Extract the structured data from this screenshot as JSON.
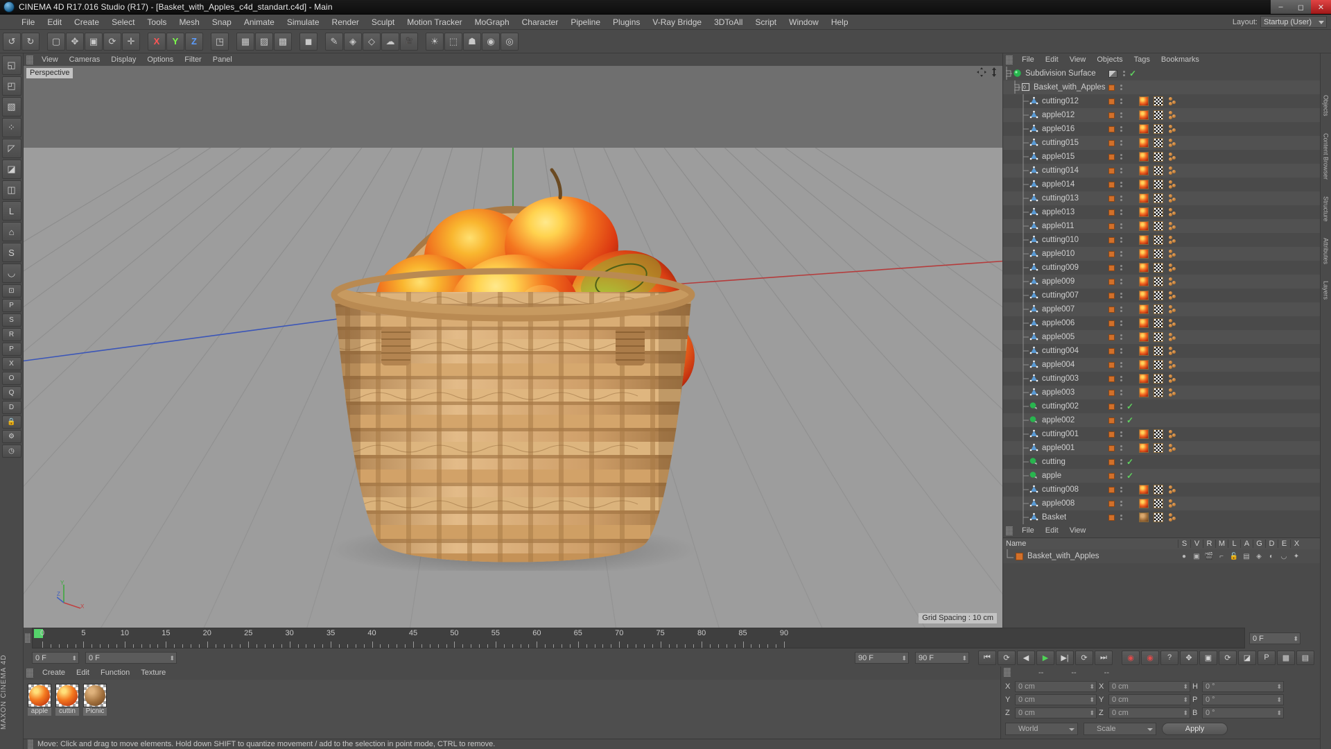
{
  "window": {
    "title": "CINEMA 4D R17.016 Studio (R17) - [Basket_with_Apples_c4d_standart.c4d] - Main",
    "app_icon": "c4d-logo-icon",
    "minimize": "–",
    "maximize": "◻",
    "close": "✕"
  },
  "menubar": {
    "items": [
      "File",
      "Edit",
      "Create",
      "Select",
      "Tools",
      "Mesh",
      "Snap",
      "Animate",
      "Simulate",
      "Render",
      "Sculpt",
      "Motion Tracker",
      "MoGraph",
      "Character",
      "Pipeline",
      "Plugins",
      "V-Ray Bridge",
      "3DToAll",
      "Script",
      "Window",
      "Help"
    ],
    "layout_label": "Layout:",
    "layout_value": "Startup (User)"
  },
  "toolbar": {
    "buttons": [
      {
        "name": "undo-button",
        "glyph": "↺"
      },
      {
        "name": "redo-button",
        "glyph": "↻"
      },
      {
        "name": "live-selection-button",
        "glyph": "▢"
      },
      {
        "name": "move-button",
        "glyph": "✥"
      },
      {
        "name": "scale-button",
        "glyph": "▣"
      },
      {
        "name": "rotate-button",
        "glyph": "⟳"
      },
      {
        "name": "coordinate-button",
        "glyph": "✛"
      },
      {
        "name": "lock-x-axis-button",
        "glyph": "X"
      },
      {
        "name": "lock-y-axis-button",
        "glyph": "Y"
      },
      {
        "name": "lock-z-axis-button",
        "glyph": "Z"
      },
      {
        "name": "world-object-coordinates-button",
        "glyph": "◳"
      },
      {
        "name": "render-view-button",
        "glyph": "▦"
      },
      {
        "name": "render-region-button",
        "glyph": "▨"
      },
      {
        "name": "render-settings-button",
        "glyph": "▩"
      },
      {
        "name": "add-cube-button",
        "glyph": "◼"
      },
      {
        "name": "add-spline-button",
        "glyph": "✎"
      },
      {
        "name": "add-generator-button",
        "glyph": "◈"
      },
      {
        "name": "add-deformer-button",
        "glyph": "◇"
      },
      {
        "name": "add-environment-button",
        "glyph": "☁"
      },
      {
        "name": "add-camera-button",
        "glyph": "🎥"
      },
      {
        "name": "add-light-button",
        "glyph": "☀"
      },
      {
        "name": "mograph-button",
        "glyph": "⬚"
      },
      {
        "name": "add-character-button",
        "glyph": "☗"
      },
      {
        "name": "add-dynamics-button",
        "glyph": "◉"
      },
      {
        "name": "add-motion-tracker-button",
        "glyph": "◎"
      }
    ]
  },
  "left_rail": {
    "buttons": [
      {
        "name": "make-editable-button",
        "glyph": "◱"
      },
      {
        "name": "model-mode-button",
        "glyph": "◰"
      },
      {
        "name": "texture-mode-button",
        "glyph": "▧"
      },
      {
        "name": "points-mode-button",
        "glyph": "⁘"
      },
      {
        "name": "edges-mode-button",
        "glyph": "◸"
      },
      {
        "name": "polygons-mode-button",
        "glyph": "◪"
      },
      {
        "name": "axis-mode-button",
        "glyph": "◫"
      },
      {
        "name": "enable-axis-button",
        "glyph": "L"
      },
      {
        "name": "workplane-button",
        "glyph": "⌂"
      },
      {
        "name": "snap-button",
        "glyph": "S"
      },
      {
        "name": "magnet-button",
        "glyph": "◡"
      },
      {
        "name": "viewport-solo-button",
        "glyph": "⊡"
      },
      {
        "name": "viewport-single-button",
        "glyph": "P"
      },
      {
        "name": "viewport-s-button",
        "glyph": "S"
      },
      {
        "name": "viewport-r-button",
        "glyph": "R"
      },
      {
        "name": "viewport-p-button",
        "glyph": "P"
      },
      {
        "name": "viewport-x-button",
        "glyph": "X"
      },
      {
        "name": "viewport-o-button",
        "glyph": "O"
      },
      {
        "name": "viewport-q-button",
        "glyph": "Q"
      },
      {
        "name": "viewport-d-button",
        "glyph": "D"
      },
      {
        "name": "lock-selection-button",
        "glyph": "🔒"
      },
      {
        "name": "settings-gear-button",
        "glyph": "⚙"
      },
      {
        "name": "render-queue-button",
        "glyph": "◷"
      }
    ],
    "brand": "MAXON CINEMA 4D"
  },
  "viewport": {
    "menu": [
      "View",
      "Cameras",
      "Display",
      "Options",
      "Filter",
      "Panel"
    ],
    "camera_label": "Perspective",
    "grid_spacing": "Grid Spacing : 10 cm",
    "pan_icon": "pan-icon",
    "zoom_icon": "zoom-icon",
    "axis_labels": {
      "x": "X",
      "y": "Y",
      "z": "Z"
    },
    "grid_color": "#8e8e8e",
    "sky_color": "#6f6f6f",
    "ground_color": "#9d9d9d",
    "axis_red": "#c04040",
    "axis_green": "#3ea83e",
    "axis_blue": "#4060c0"
  },
  "object_manager": {
    "menu": [
      "File",
      "Edit",
      "View",
      "Objects",
      "Tags",
      "Bookmarks"
    ],
    "rows": [
      {
        "name": "Subdivision Surface",
        "depth": 0,
        "icon": "subdivision-surface-icon",
        "icon_color": "#29b54f",
        "swatch": "checker",
        "check": true,
        "tags": []
      },
      {
        "name": "Basket_with_Apples",
        "depth": 1,
        "icon": "layer-object-icon",
        "icon_color": "#cfcfcf",
        "swatch": "orange",
        "check": false,
        "tags": []
      },
      {
        "name": "cutting012",
        "depth": 2,
        "icon": "polygon-object-icon",
        "icon_color": "#5b9bd5",
        "swatch": "orange",
        "check": false,
        "tags": [
          "apple",
          "checker",
          "dots"
        ]
      },
      {
        "name": "apple012",
        "depth": 2,
        "icon": "polygon-object-icon",
        "icon_color": "#5b9bd5",
        "swatch": "orange",
        "check": false,
        "tags": [
          "apple",
          "checker",
          "dots"
        ]
      },
      {
        "name": "apple016",
        "depth": 2,
        "icon": "polygon-object-icon",
        "icon_color": "#5b9bd5",
        "swatch": "orange",
        "check": false,
        "tags": [
          "apple",
          "checker",
          "dots"
        ]
      },
      {
        "name": "cutting015",
        "depth": 2,
        "icon": "polygon-object-icon",
        "icon_color": "#5b9bd5",
        "swatch": "orange",
        "check": false,
        "tags": [
          "apple",
          "checker",
          "dots"
        ]
      },
      {
        "name": "apple015",
        "depth": 2,
        "icon": "polygon-object-icon",
        "icon_color": "#5b9bd5",
        "swatch": "orange",
        "check": false,
        "tags": [
          "apple",
          "checker",
          "dots"
        ]
      },
      {
        "name": "cutting014",
        "depth": 2,
        "icon": "polygon-object-icon",
        "icon_color": "#5b9bd5",
        "swatch": "orange",
        "check": false,
        "tags": [
          "apple",
          "checker",
          "dots"
        ]
      },
      {
        "name": "apple014",
        "depth": 2,
        "icon": "polygon-object-icon",
        "icon_color": "#5b9bd5",
        "swatch": "orange",
        "check": false,
        "tags": [
          "apple",
          "checker",
          "dots"
        ]
      },
      {
        "name": "cutting013",
        "depth": 2,
        "icon": "polygon-object-icon",
        "icon_color": "#5b9bd5",
        "swatch": "orange",
        "check": false,
        "tags": [
          "apple",
          "checker",
          "dots"
        ]
      },
      {
        "name": "apple013",
        "depth": 2,
        "icon": "polygon-object-icon",
        "icon_color": "#5b9bd5",
        "swatch": "orange",
        "check": false,
        "tags": [
          "apple",
          "checker",
          "dots"
        ]
      },
      {
        "name": "apple011",
        "depth": 2,
        "icon": "polygon-object-icon",
        "icon_color": "#5b9bd5",
        "swatch": "orange",
        "check": false,
        "tags": [
          "apple",
          "checker",
          "dots"
        ]
      },
      {
        "name": "cutting010",
        "depth": 2,
        "icon": "polygon-object-icon",
        "icon_color": "#5b9bd5",
        "swatch": "orange",
        "check": false,
        "tags": [
          "apple",
          "checker",
          "dots"
        ]
      },
      {
        "name": "apple010",
        "depth": 2,
        "icon": "polygon-object-icon",
        "icon_color": "#5b9bd5",
        "swatch": "orange",
        "check": false,
        "tags": [
          "apple",
          "checker",
          "dots"
        ]
      },
      {
        "name": "cutting009",
        "depth": 2,
        "icon": "polygon-object-icon",
        "icon_color": "#5b9bd5",
        "swatch": "orange",
        "check": false,
        "tags": [
          "apple",
          "checker",
          "dots"
        ]
      },
      {
        "name": "apple009",
        "depth": 2,
        "icon": "polygon-object-icon",
        "icon_color": "#5b9bd5",
        "swatch": "orange",
        "check": false,
        "tags": [
          "apple",
          "checker",
          "dots"
        ]
      },
      {
        "name": "cutting007",
        "depth": 2,
        "icon": "polygon-object-icon",
        "icon_color": "#5b9bd5",
        "swatch": "orange",
        "check": false,
        "tags": [
          "apple",
          "checker",
          "dots"
        ]
      },
      {
        "name": "apple007",
        "depth": 2,
        "icon": "polygon-object-icon",
        "icon_color": "#5b9bd5",
        "swatch": "orange",
        "check": false,
        "tags": [
          "apple",
          "checker",
          "dots"
        ]
      },
      {
        "name": "apple006",
        "depth": 2,
        "icon": "polygon-object-icon",
        "icon_color": "#5b9bd5",
        "swatch": "orange",
        "check": false,
        "tags": [
          "apple",
          "checker",
          "dots"
        ]
      },
      {
        "name": "apple005",
        "depth": 2,
        "icon": "polygon-object-icon",
        "icon_color": "#5b9bd5",
        "swatch": "orange",
        "check": false,
        "tags": [
          "apple",
          "checker",
          "dots"
        ]
      },
      {
        "name": "cutting004",
        "depth": 2,
        "icon": "polygon-object-icon",
        "icon_color": "#5b9bd5",
        "swatch": "orange",
        "check": false,
        "tags": [
          "apple",
          "checker",
          "dots"
        ]
      },
      {
        "name": "apple004",
        "depth": 2,
        "icon": "polygon-object-icon",
        "icon_color": "#5b9bd5",
        "swatch": "orange",
        "check": false,
        "tags": [
          "apple",
          "checker",
          "dots"
        ]
      },
      {
        "name": "cutting003",
        "depth": 2,
        "icon": "polygon-object-icon",
        "icon_color": "#5b9bd5",
        "swatch": "orange",
        "check": false,
        "tags": [
          "apple",
          "checker",
          "dots"
        ]
      },
      {
        "name": "apple003",
        "depth": 2,
        "icon": "polygon-object-icon",
        "icon_color": "#5b9bd5",
        "swatch": "orange",
        "check": false,
        "tags": [
          "apple",
          "checker",
          "dots"
        ]
      },
      {
        "name": "cutting002",
        "depth": 2,
        "icon": "instance-object-icon",
        "icon_color": "#29b54f",
        "swatch": "orange",
        "check": true,
        "tags": []
      },
      {
        "name": "apple002",
        "depth": 2,
        "icon": "instance-object-icon",
        "icon_color": "#29b54f",
        "swatch": "orange",
        "check": true,
        "tags": []
      },
      {
        "name": "cutting001",
        "depth": 2,
        "icon": "polygon-object-icon",
        "icon_color": "#5b9bd5",
        "swatch": "orange",
        "check": false,
        "tags": [
          "apple",
          "checker",
          "dots"
        ]
      },
      {
        "name": "apple001",
        "depth": 2,
        "icon": "polygon-object-icon",
        "icon_color": "#5b9bd5",
        "swatch": "orange",
        "check": false,
        "tags": [
          "apple",
          "checker",
          "dots"
        ]
      },
      {
        "name": "cutting",
        "depth": 2,
        "icon": "instance-object-icon",
        "icon_color": "#29b54f",
        "swatch": "orange",
        "check": true,
        "tags": []
      },
      {
        "name": "apple",
        "depth": 2,
        "icon": "instance-object-icon",
        "icon_color": "#29b54f",
        "swatch": "orange",
        "check": true,
        "tags": []
      },
      {
        "name": "cutting008",
        "depth": 2,
        "icon": "polygon-object-icon",
        "icon_color": "#5b9bd5",
        "swatch": "orange",
        "check": false,
        "tags": [
          "apple",
          "checker",
          "dots"
        ]
      },
      {
        "name": "apple008",
        "depth": 2,
        "icon": "polygon-object-icon",
        "icon_color": "#5b9bd5",
        "swatch": "orange",
        "check": false,
        "tags": [
          "apple",
          "checker",
          "dots"
        ]
      },
      {
        "name": "Basket",
        "depth": 2,
        "icon": "polygon-object-icon",
        "icon_color": "#5b9bd5",
        "swatch": "orange",
        "check": false,
        "tags": [
          "wood",
          "checker",
          "dots"
        ]
      }
    ]
  },
  "layer_manager": {
    "menu": [
      "File",
      "Edit",
      "View"
    ],
    "columns": [
      "Name",
      "S",
      "V",
      "R",
      "M",
      "L",
      "A",
      "G",
      "D",
      "E",
      "X"
    ],
    "rows": [
      {
        "name": "Basket_with_Apples",
        "color": "#d2702a",
        "icons": [
          "solo-dot-icon",
          "view-icon",
          "render-icon",
          "manager-icon",
          "lock-icon",
          "animation-icon",
          "generator-icon",
          "deformer-icon",
          "expression-icon",
          "xref-icon"
        ]
      }
    ]
  },
  "timeline": {
    "start_frame": "0 F",
    "current_frame": "0 F",
    "end_frame_left": "90 F",
    "end_frame_right": "90 F",
    "preview_end": "0 F",
    "ticks": [
      0,
      5,
      10,
      15,
      20,
      25,
      30,
      35,
      40,
      45,
      50,
      55,
      60,
      65,
      70,
      75,
      80,
      85,
      90
    ],
    "transport": [
      {
        "name": "go-to-start-button",
        "glyph": "⏮"
      },
      {
        "name": "loop-button",
        "glyph": "⟳"
      },
      {
        "name": "step-back-button",
        "glyph": "◀"
      },
      {
        "name": "play-button",
        "glyph": "▶"
      },
      {
        "name": "step-forward-button",
        "glyph": "▶|"
      },
      {
        "name": "play-forward-button",
        "glyph": "⟳"
      },
      {
        "name": "go-to-end-button",
        "glyph": "⏭"
      }
    ],
    "record_tools": [
      {
        "name": "record-active-objects-button",
        "glyph": "◉"
      },
      {
        "name": "autokeying-button",
        "glyph": "◉"
      },
      {
        "name": "keyframe-selection-button",
        "glyph": "?"
      },
      {
        "name": "position-key-button",
        "glyph": "✥"
      },
      {
        "name": "scale-key-button",
        "glyph": "▣"
      },
      {
        "name": "rotation-key-button",
        "glyph": "⟳"
      },
      {
        "name": "parameter-key-button",
        "glyph": "◪"
      },
      {
        "name": "pla-key-button",
        "glyph": "P"
      },
      {
        "name": "dope-sheet-button",
        "glyph": "▦"
      },
      {
        "name": "timeline-button",
        "glyph": "▤"
      }
    ]
  },
  "material_manager": {
    "menu": [
      "Create",
      "Edit",
      "Function",
      "Texture"
    ],
    "materials": [
      {
        "name": "apple",
        "label": "apple",
        "type": "apple"
      },
      {
        "name": "cutting",
        "label": "cuttin",
        "type": "apple"
      },
      {
        "name": "Picnic",
        "label": "Picnic",
        "type": "wood"
      }
    ]
  },
  "coordinates": {
    "header_left": "--",
    "header_mid": "--",
    "header_right": "--",
    "position": [
      {
        "label": "X",
        "value": "0 cm"
      },
      {
        "label": "Y",
        "value": "0 cm"
      },
      {
        "label": "Z",
        "value": "0 cm"
      }
    ],
    "size": [
      {
        "label": "X",
        "value": "0 cm"
      },
      {
        "label": "Y",
        "value": "0 cm"
      },
      {
        "label": "Z",
        "value": "0 cm"
      }
    ],
    "rotation": [
      {
        "label": "H",
        "value": "0 °"
      },
      {
        "label": "P",
        "value": "0 °"
      },
      {
        "label": "B",
        "value": "0 °"
      }
    ],
    "coord_system": "World",
    "size_mode": "Scale",
    "apply_label": "Apply"
  },
  "statusbar": {
    "message": "Move: Click and drag to move elements. Hold down SHIFT to quantize movement / add to the selection in point mode, CTRL to remove."
  },
  "right_edge_tabs": [
    "Objects",
    "Content Browser",
    "Structure",
    "Attributes",
    "Layers"
  ]
}
